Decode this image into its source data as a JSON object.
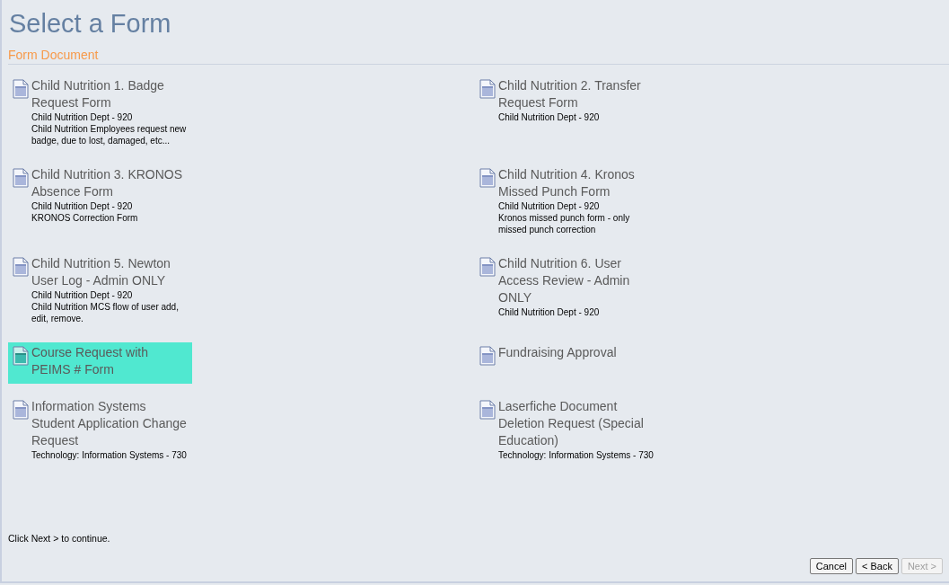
{
  "title": "Select a Form",
  "section": "Form Document",
  "forms": [
    {
      "title": "Child Nutrition 1. Badge Request Form",
      "details": [
        "Child Nutrition Dept - 920",
        "Child Nutrition Employees request new badge, due to lost, damaged, etc..."
      ],
      "selected": false
    },
    {
      "title": "Child Nutrition 2. Transfer Request Form",
      "details": [
        "Child Nutrition Dept - 920"
      ],
      "selected": false
    },
    {
      "title": "Child Nutrition 3. KRONOS Absence Form",
      "details": [
        "Child Nutrition Dept - 920",
        "KRONOS Correction Form"
      ],
      "selected": false
    },
    {
      "title": "Child Nutrition 4. Kronos Missed Punch Form",
      "details": [
        "Child Nutrition Dept - 920",
        "Kronos missed punch form - only missed punch correction"
      ],
      "selected": false
    },
    {
      "title": "Child Nutrition 5. Newton User Log - Admin ONLY",
      "details": [
        "Child Nutrition Dept - 920",
        "Child Nutrition MCS flow of user add, edit, remove."
      ],
      "selected": false
    },
    {
      "title": "Child Nutrition 6. User Access Review - Admin ONLY",
      "details": [
        "Child Nutrition Dept - 920"
      ],
      "selected": false
    },
    {
      "title": "Course Request with PEIMS # Form",
      "selected": true
    },
    {
      "title": "Fundraising Approval",
      "selected": false
    },
    {
      "title": "Information Systems Student Application Change Request",
      "details": [
        "Technology: Information Systems - 730"
      ],
      "selected": false
    },
    {
      "title": "Laserfiche Document Deletion Request (Special Education)",
      "details": [
        "Technology: Information Systems - 730"
      ],
      "selected": false
    }
  ],
  "hint": "Click Next > to continue.",
  "buttons": [
    {
      "label": "Cancel",
      "disabled": false
    },
    {
      "label": "< Back",
      "disabled": false
    },
    {
      "label": "Next >",
      "disabled": true
    }
  ]
}
